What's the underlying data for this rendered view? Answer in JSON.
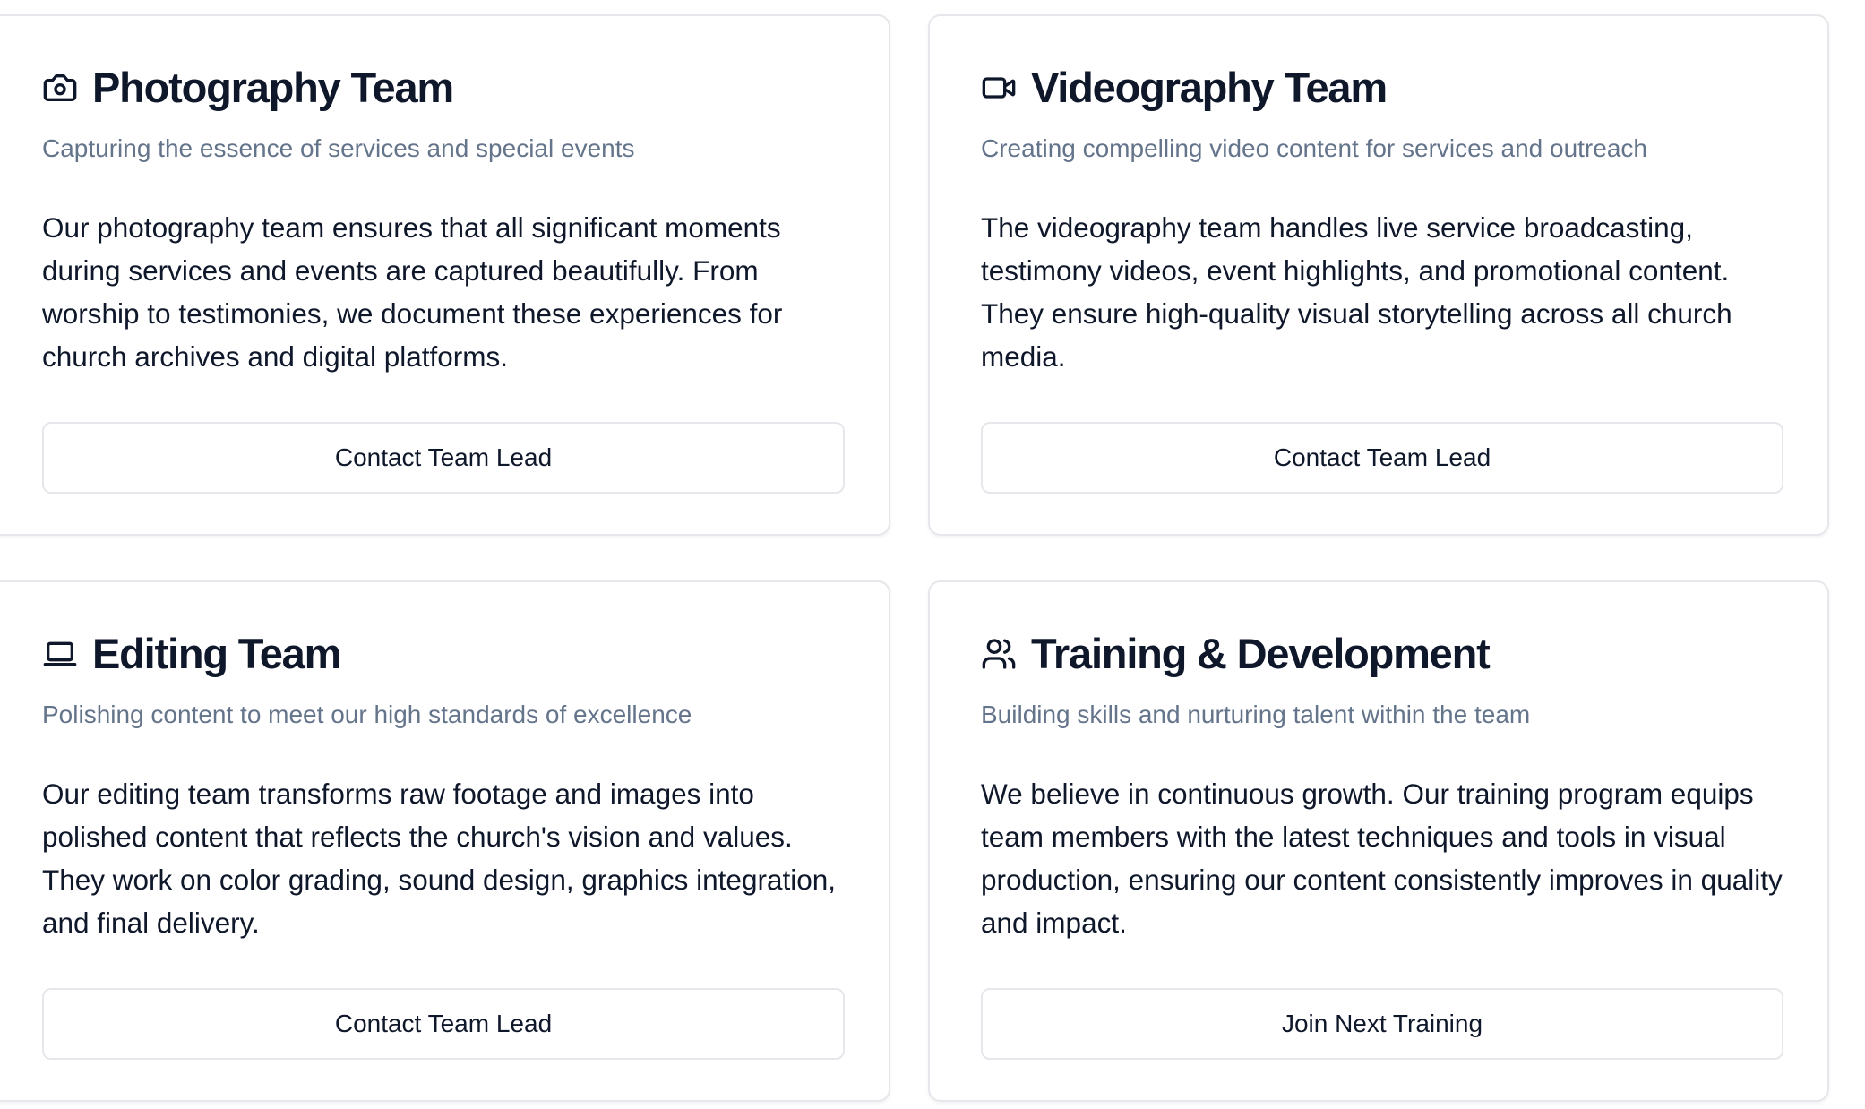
{
  "cards": [
    {
      "icon": "camera-icon",
      "title": "Photography Team",
      "subtitle": "Capturing the essence of services and special events",
      "description": "Our photography team ensures that all significant moments during services and events are captured beautifully. From worship to testimonies, we document these experiences for church archives and digital platforms.",
      "button_label": "Contact Team Lead"
    },
    {
      "icon": "video-camera-icon",
      "title": "Videography Team",
      "subtitle": "Creating compelling video content for services and outreach",
      "description": "The videography team handles live service broadcasting, testimony videos, event highlights, and promotional content. They ensure high-quality visual storytelling across all church media.",
      "button_label": "Contact Team Lead"
    },
    {
      "icon": "laptop-icon",
      "title": "Editing Team",
      "subtitle": "Polishing content to meet our high standards of excellence",
      "description": "Our editing team transforms raw footage and images into polished content that reflects the church's vision and values. They work on color grading, sound design, graphics integration, and final delivery.",
      "button_label": "Contact Team Lead"
    },
    {
      "icon": "users-icon",
      "title": "Training & Development",
      "subtitle": "Building skills and nurturing talent within the team",
      "description": "We believe in continuous growth. Our training program equips team members with the latest techniques and tools in visual production, ensuring our content consistently improves in quality and impact.",
      "button_label": "Join Next Training"
    }
  ],
  "colors": {
    "text_primary": "#0f172a",
    "text_muted": "#64748b",
    "border": "#e5e7eb",
    "background": "#ffffff"
  }
}
